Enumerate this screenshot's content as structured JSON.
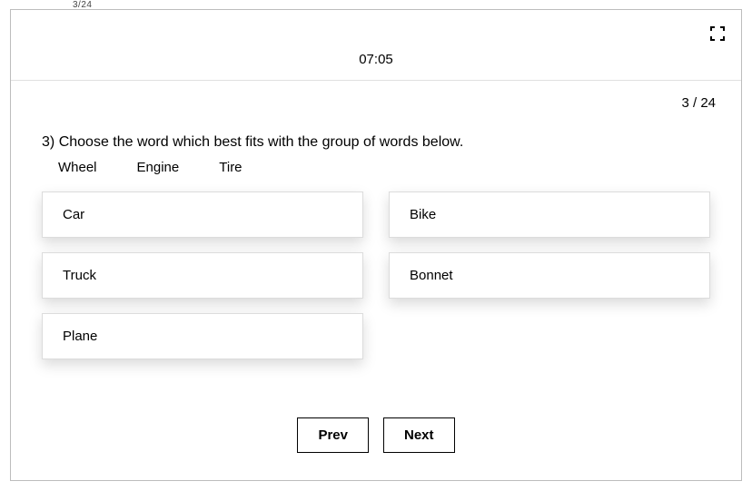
{
  "outer_label": "3/24",
  "timer": "07:05",
  "progress": "3 / 24",
  "question": {
    "number": "3)",
    "text": "Choose the word which best fits with the group of words below.",
    "hints": [
      "Wheel",
      "Engine",
      "Tire"
    ],
    "options": [
      "Car",
      "Bike",
      "Truck",
      "Bonnet",
      "Plane"
    ]
  },
  "nav": {
    "prev_label": "Prev",
    "next_label": "Next"
  },
  "icons": {
    "fullscreen": "fullscreen-icon"
  }
}
